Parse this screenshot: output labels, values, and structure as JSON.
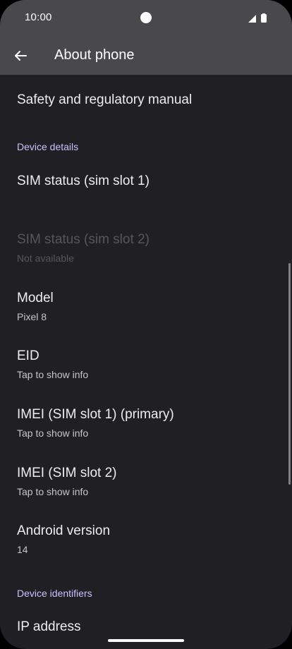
{
  "status_bar": {
    "time": "10:00"
  },
  "app_bar": {
    "title": "About phone",
    "back_icon": "arrow-back-icon"
  },
  "items": {
    "safety": {
      "title": "Safety and regulatory manual"
    },
    "device_details_header": "Device details",
    "sim1": {
      "title": "SIM status (sim slot 1)"
    },
    "sim2": {
      "title": "SIM status (sim slot 2)",
      "subtitle": "Not available"
    },
    "model": {
      "title": "Model",
      "subtitle": "Pixel 8"
    },
    "eid": {
      "title": "EID",
      "subtitle": "Tap to show info"
    },
    "imei1": {
      "title": "IMEI (SIM slot 1) (primary)",
      "subtitle": "Tap to show info"
    },
    "imei2": {
      "title": "IMEI (SIM slot 2)",
      "subtitle": "Tap to show info"
    },
    "android": {
      "title": "Android version",
      "subtitle": "14"
    },
    "device_identifiers_header": "Device identifiers",
    "ip": {
      "title": "IP address"
    }
  },
  "colors": {
    "accent_header": "#c9c2ff",
    "background": "#202024",
    "app_bar": "#49494b"
  }
}
